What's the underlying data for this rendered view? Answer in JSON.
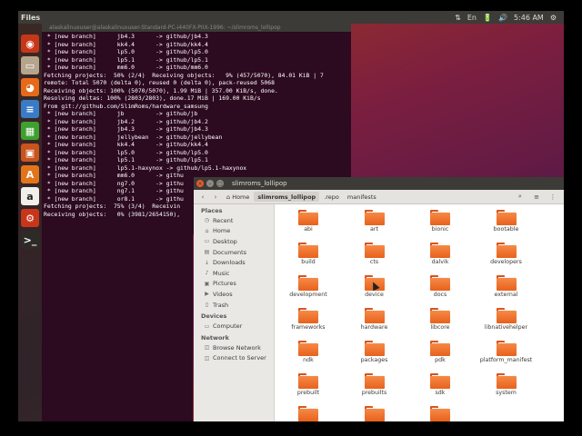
{
  "top_panel": {
    "app_name": "Files",
    "indicators": [
      "⇅",
      "En",
      "🔋",
      "🔊"
    ],
    "clock": "5:46 AM",
    "gear": "⚙"
  },
  "launcher": {
    "items": [
      {
        "name": "dash-icon",
        "glyph": "◉",
        "color": "#c8361a"
      },
      {
        "name": "files-icon",
        "glyph": "▭",
        "color": "#b5a58d"
      },
      {
        "name": "firefox-icon",
        "glyph": "◕",
        "color": "#e66a1a"
      },
      {
        "name": "libreoffice-writer-icon",
        "glyph": "≡",
        "color": "#3a7bc8"
      },
      {
        "name": "libreoffice-calc-icon",
        "glyph": "▦",
        "color": "#3ea02f"
      },
      {
        "name": "libreoffice-impress-icon",
        "glyph": "▣",
        "color": "#c9541e"
      },
      {
        "name": "software-center-icon",
        "glyph": "A",
        "color": "#e2741b"
      },
      {
        "name": "amazon-icon",
        "glyph": "a",
        "color": "#f1efe9"
      },
      {
        "name": "settings-icon",
        "glyph": "⚙",
        "color": "#c8361a"
      },
      {
        "name": "terminal-icon",
        "glyph": ">_",
        "color": "#2d2b28"
      }
    ]
  },
  "terminal": {
    "title": "alaskalinuxuser@alaskalinuxuser-Standard-PC-i440FX-PIIX-1996: ~/slimroms_lollipop",
    "lines": [
      " * [new branch]      jb4.3      -> github/jb4.3",
      " * [new branch]      kk4.4      -> github/kk4.4",
      " * [new branch]      lp5.0      -> github/lp5.0",
      " * [new branch]      lp5.1      -> github/lp5.1",
      " * [new branch]      mm6.0      -> github/mm6.0",
      "Fetching projects:  50% (2/4)  Receiving objects:   9% (457/5070), 84.01 KiB | 7",
      "remote: Total 5070 (delta 0), reused 0 (delta 0), pack-reused 5068",
      "Receiving objects: 100% (5070/5070), 1.99 MiB | 357.00 KiB/s, done.",
      "Resolving deltas: 100% (2803/2803), done.17 MiB | 169.00 KiB/s",
      "From git://github.com/SlimRoms/hardware_samsung",
      " * [new branch]      jb         -> github/jb",
      " * [new branch]      jb4.2      -> github/jb4.2",
      " * [new branch]      jb4.3      -> github/jb4.3",
      " * [new branch]      jellybean  -> github/jellybean",
      " * [new branch]      kk4.4      -> github/kk4.4",
      " * [new branch]      lp5.0      -> github/lp5.0",
      " * [new branch]      lp5.1      -> github/lp5.1",
      " * [new branch]      lp5.1-haxynox -> github/lp5.1-haxynox",
      " * [new branch]      mm6.0      -> githu",
      " * [new branch]      ng7.0      -> githu",
      " * [new branch]      ng7.1      -> githu",
      " * [new branch]      or8.1      -> githu",
      "Fetching projects:  75% (3/4)  Receivin",
      "Receiving objects:   0% (3981/2654150),"
    ]
  },
  "files": {
    "title": "slimroms_lollipop",
    "nav": {
      "back": "‹",
      "forward": "›"
    },
    "breadcrumbs": [
      {
        "label": "⌂ Home",
        "active": false
      },
      {
        "label": "slimroms_lollipop",
        "active": true
      },
      {
        "label": ".repo",
        "active": false
      },
      {
        "label": "manifests",
        "active": false
      }
    ],
    "toolbar_icons": {
      "search": "⌕",
      "list": "≡",
      "menu": "⋮"
    },
    "sidebar": [
      {
        "heading": "Places",
        "items": [
          {
            "label": "Recent",
            "icon": "◷"
          },
          {
            "label": "Home",
            "icon": "⌂"
          },
          {
            "label": "Desktop",
            "icon": "▭"
          },
          {
            "label": "Documents",
            "icon": "▤"
          },
          {
            "label": "Downloads",
            "icon": "↓"
          },
          {
            "label": "Music",
            "icon": "♪"
          },
          {
            "label": "Pictures",
            "icon": "▣"
          },
          {
            "label": "Videos",
            "icon": "▶"
          },
          {
            "label": "Trash",
            "icon": "▯"
          }
        ]
      },
      {
        "heading": "Devices",
        "items": [
          {
            "label": "Computer",
            "icon": "▭"
          }
        ]
      },
      {
        "heading": "Network",
        "items": [
          {
            "label": "Browse Network",
            "icon": "◫"
          },
          {
            "label": "Connect to Server",
            "icon": "◫"
          }
        ]
      }
    ],
    "folders": [
      "abi",
      "art",
      "bionic",
      "bootable",
      "build",
      "cts",
      "dalvik",
      "developers",
      "development",
      "device",
      "docs",
      "external",
      "frameworks",
      "hardware",
      "libcore",
      "libnativehelper",
      "ndk",
      "packages",
      "pdk",
      "platform_manifest",
      "prebuilt",
      "prebuilts",
      "sdk",
      "system",
      "",
      "",
      ""
    ]
  },
  "colors": {
    "folder": "#e8611d",
    "ubuntu_panel": "#3c3b37",
    "terminal_bg": "#2c0a1f"
  }
}
